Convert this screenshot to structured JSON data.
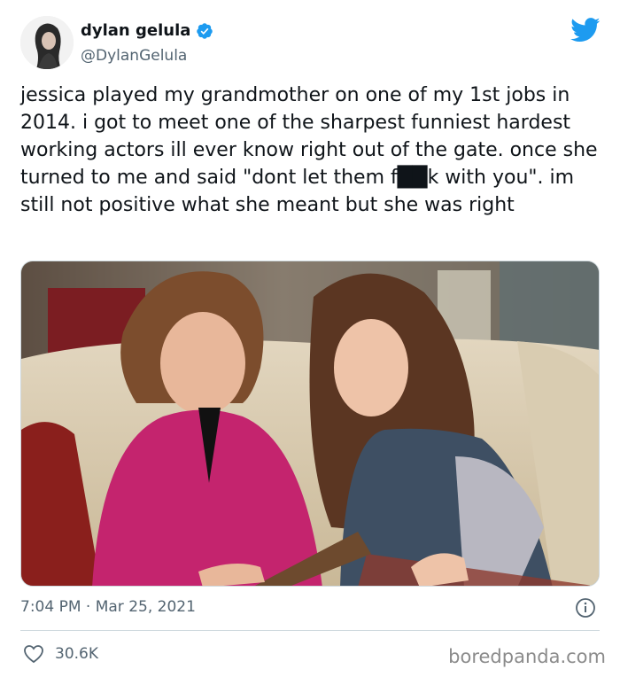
{
  "user": {
    "name": "dylan gelula",
    "handle": "@DylanGelula"
  },
  "tweet": {
    "text": "jessica played my grandmother on one of my 1st jobs in 2014. i got to meet one of the sharpest funniest hardest working actors ill ever know right out of the gate. once she turned to me and said \"dont let them f██k with you\". im still not positive what she meant but she was right",
    "timestamp": "7:04 PM · Mar 25, 2021",
    "likes": "30.6K"
  },
  "watermark": "boredpanda.com",
  "colors": {
    "brand": "#1d9bf0",
    "text": "#0f1419",
    "secondary": "#536471"
  }
}
